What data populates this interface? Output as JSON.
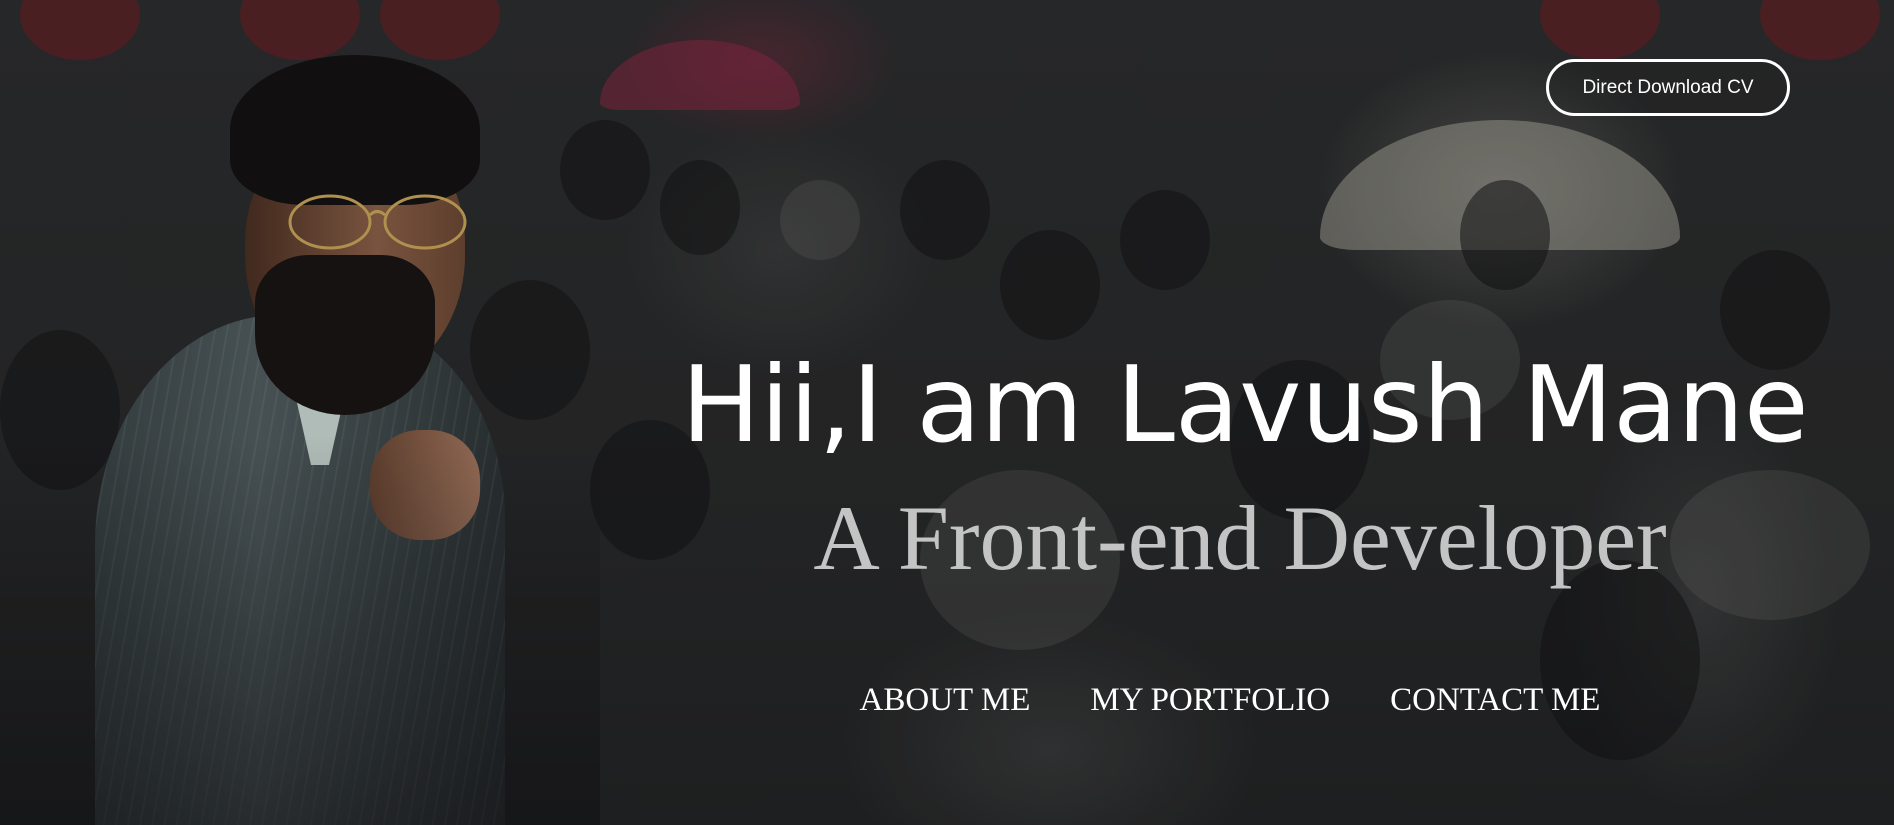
{
  "header": {
    "cta_label": "Direct Download CV"
  },
  "hero": {
    "headline": "Hii,I am Lavush Mane",
    "subheadline": "A Front-end Developer",
    "background_image": "crowd-photo",
    "portrait_image": "profile-portrait"
  },
  "nav": {
    "items": [
      {
        "label": "ABOUT ME"
      },
      {
        "label": "MY PORTFOLIO"
      },
      {
        "label": "CONTACT ME"
      }
    ]
  },
  "colors": {
    "headline": "#ffffff",
    "subheadline": "#c4c4c4",
    "button_border": "#ffffff",
    "background": "#2a2b2c"
  }
}
